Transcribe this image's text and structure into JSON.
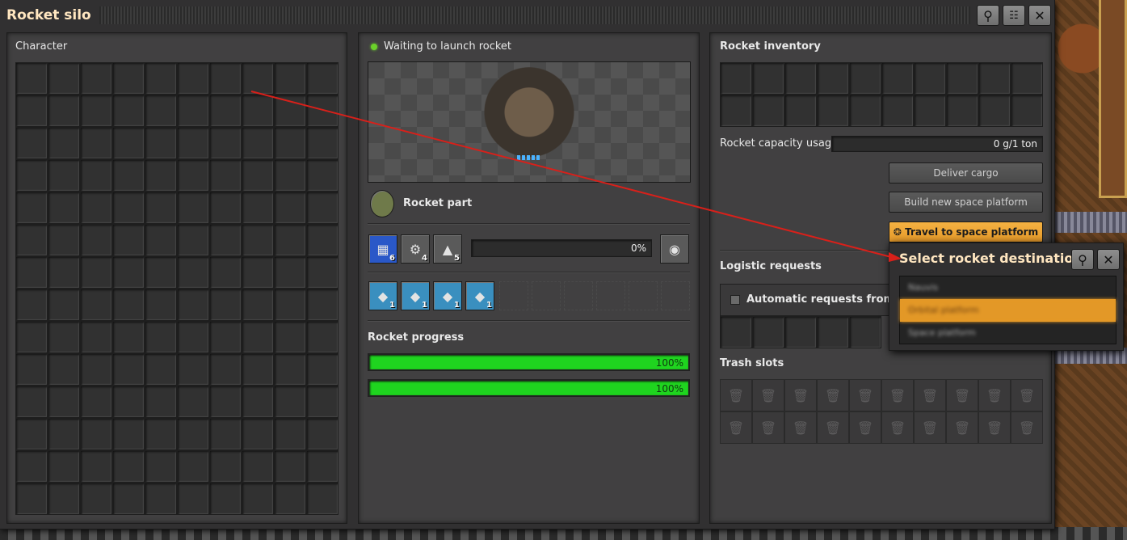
{
  "window": {
    "title": "Rocket silo"
  },
  "titlebar": {
    "search_icon": "search-icon",
    "network_icon": "network-icon",
    "close_icon": "close-icon"
  },
  "character": {
    "label": "Character"
  },
  "silo": {
    "status": "Waiting to launch rocket",
    "status_color": "#6bd12a",
    "recipe_label": "Rocket part",
    "ingredients": [
      {
        "name": "processing-unit",
        "count": "6"
      },
      {
        "name": "low-density-structure",
        "count": "4"
      },
      {
        "name": "rocket-fuel",
        "count": "5"
      }
    ],
    "craft_progress": "0%",
    "modules": [
      {
        "name": "module",
        "count": "1"
      },
      {
        "name": "module",
        "count": "1"
      },
      {
        "name": "module",
        "count": "1"
      },
      {
        "name": "module",
        "count": "1"
      }
    ],
    "rocket_progress_label": "Rocket progress",
    "progress_bars": [
      "100%",
      "100%"
    ]
  },
  "rocket_inventory": {
    "label": "Rocket inventory",
    "capacity_label": "Rocket capacity usage",
    "capacity_value": "0 g/1 ton",
    "deliver_button": "Deliver cargo",
    "build_button": "Build new space platform",
    "travel_button": "Travel to space platform",
    "logistic_label": "Logistic requests",
    "auto_requests": "Automatic requests from spa",
    "trash_label": "Trash slots"
  },
  "destination_popup": {
    "title": "Select rocket destination",
    "items": [
      {
        "label": "Nauvis",
        "selected": false
      },
      {
        "label": "Orbital platform",
        "selected": true
      },
      {
        "label": "Space platform",
        "selected": false
      }
    ]
  },
  "colors": {
    "accent": "#e39827",
    "progress_green": "#1fd41f",
    "title": "#ffe6c0"
  }
}
